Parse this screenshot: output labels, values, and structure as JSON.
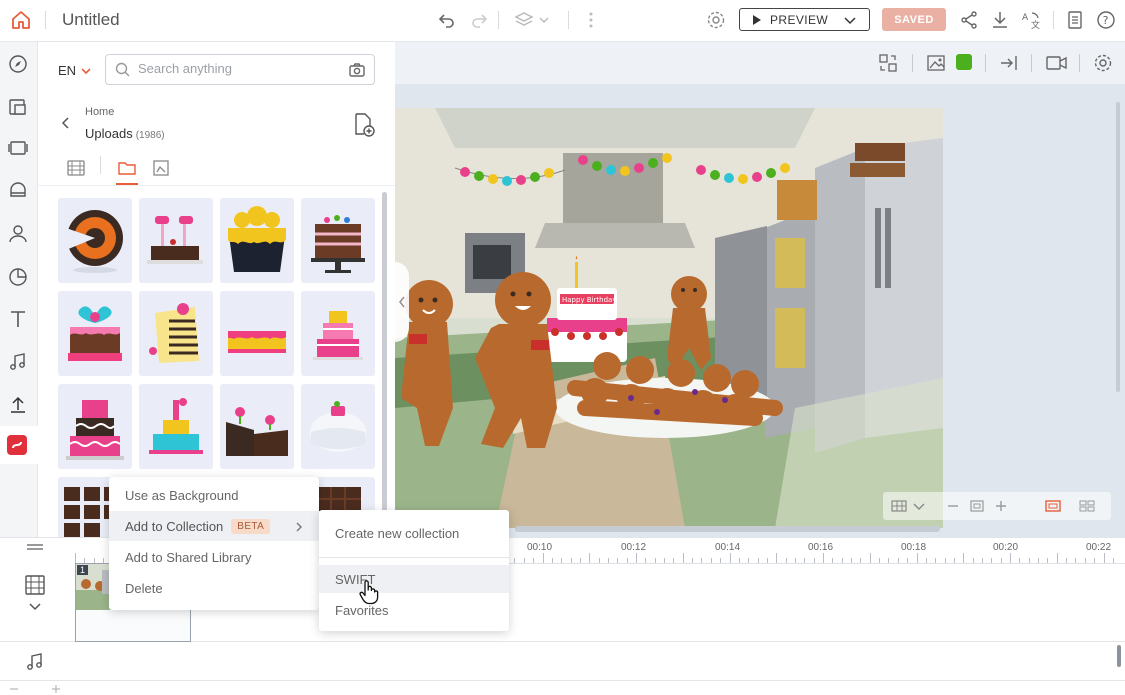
{
  "app": {
    "doc_title": "Untitled",
    "preview_label": "PREVIEW",
    "saved_label": "SAVED",
    "brand_color": "#e85d3a"
  },
  "library": {
    "language": "EN",
    "search_placeholder": "Search anything",
    "breadcrumb_parent": "Home",
    "folder_name": "Uploads",
    "folder_count": "(1986)"
  },
  "context_menu": {
    "items": [
      "Use as Background",
      "Add to Collection",
      "Add to Shared Library",
      "Delete"
    ],
    "beta_badge": "BETA",
    "submenu": {
      "create_label": "Create new collection",
      "collections": [
        "SWIFT",
        "Favorites"
      ]
    }
  },
  "canvas": {
    "scene_banner": "Happy Birthday",
    "accent_swatch": "#4caf1e"
  },
  "timeline": {
    "ticks": [
      "00:10",
      "00:12",
      "00:14",
      "00:16",
      "00:18",
      "00:20",
      "00:22"
    ],
    "scene_number": "1"
  }
}
